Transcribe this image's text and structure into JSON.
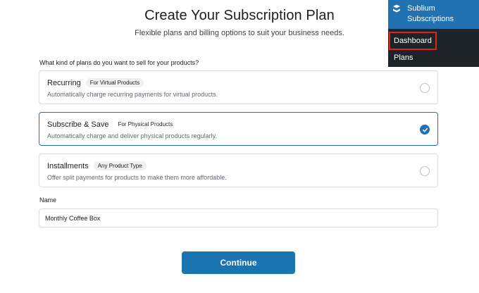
{
  "page": {
    "title": "Create Your Subscription Plan",
    "subtitle": "Flexible plans and billing options to suit your business needs."
  },
  "plans": {
    "question": "What kind of plans do you want to sell for your products?",
    "options": [
      {
        "title": "Recurring",
        "badge": "For Virtual Products",
        "description": "Automatically charge recurring payments for virtual products.",
        "selected": false
      },
      {
        "title": "Subscribe & Save",
        "badge": "For Physical Products",
        "description": "Automatically charge and deliver physical products regularly.",
        "selected": true
      },
      {
        "title": "Installments",
        "badge": "Any Product Type",
        "description": "Offer split payments for products to make them more affordable.",
        "selected": false
      }
    ]
  },
  "name_field": {
    "label": "Name",
    "value": "Monthly Coffee Box"
  },
  "actions": {
    "continue_label": "Continue"
  },
  "admin_menu": {
    "title_line1": "Sublium",
    "title_line2": "Subscriptions",
    "items": [
      "Dashboard",
      "Plans"
    ]
  },
  "colors": {
    "accent": "#2271b1",
    "button": "#1a74b0",
    "highlight_box": "#e0231c",
    "menu_bg": "#1d2327"
  }
}
